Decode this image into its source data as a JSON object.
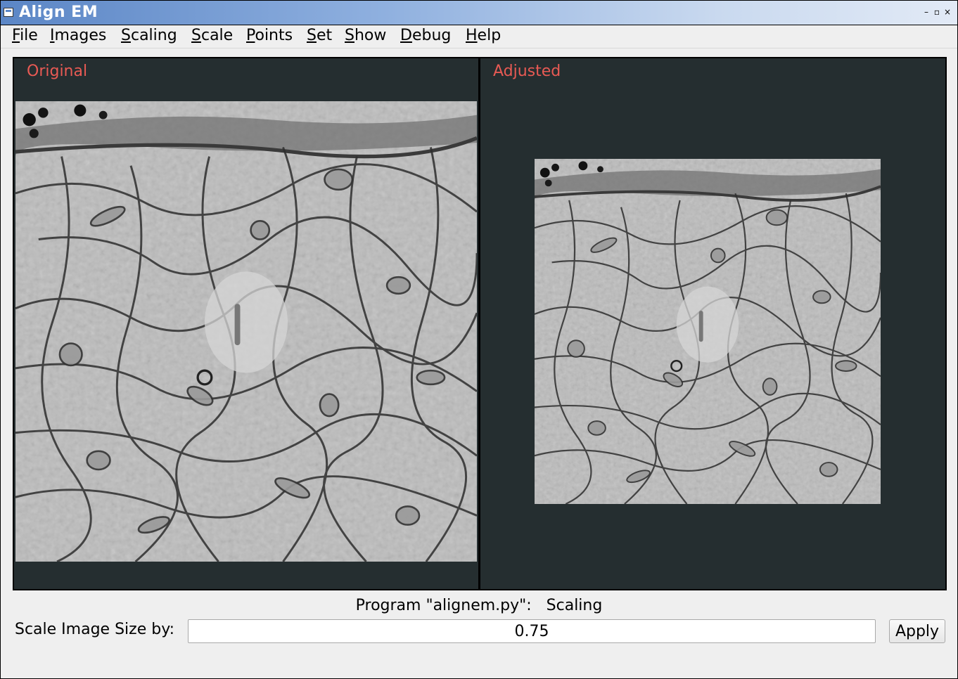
{
  "window": {
    "title": "Align EM",
    "controls": [
      "–",
      "▫",
      "×"
    ]
  },
  "menu": {
    "items": [
      {
        "label": "File",
        "mnemonic": "F",
        "rest": "ile"
      },
      {
        "label": "Images",
        "mnemonic": "I",
        "rest": "mages"
      },
      {
        "label": "Scaling",
        "mnemonic": "S",
        "rest": "caling"
      },
      {
        "label": "Scale",
        "mnemonic": "S",
        "rest": "cale"
      },
      {
        "label": "Points",
        "mnemonic": "P",
        "rest": "oints"
      },
      {
        "label": "Set",
        "mnemonic": "S",
        "rest": "et"
      },
      {
        "label": "Show",
        "mnemonic": "S",
        "rest": "how"
      },
      {
        "label": "Debug",
        "mnemonic": "D",
        "rest": "ebug"
      },
      {
        "label": "Help",
        "mnemonic": "H",
        "rest": "elp"
      }
    ]
  },
  "panels": {
    "original": {
      "label": "Original"
    },
    "adjusted": {
      "label": "Adjusted"
    }
  },
  "status": {
    "program": "Program \"alignem.py\":",
    "mode": "Scaling"
  },
  "scale": {
    "label": "Scale Image Size by:",
    "value": "0.75",
    "apply_label": "Apply"
  },
  "colors": {
    "panel_bg": "#252e30",
    "label_accent": "#e85a54",
    "titlebar_start": "#5b86c6"
  }
}
